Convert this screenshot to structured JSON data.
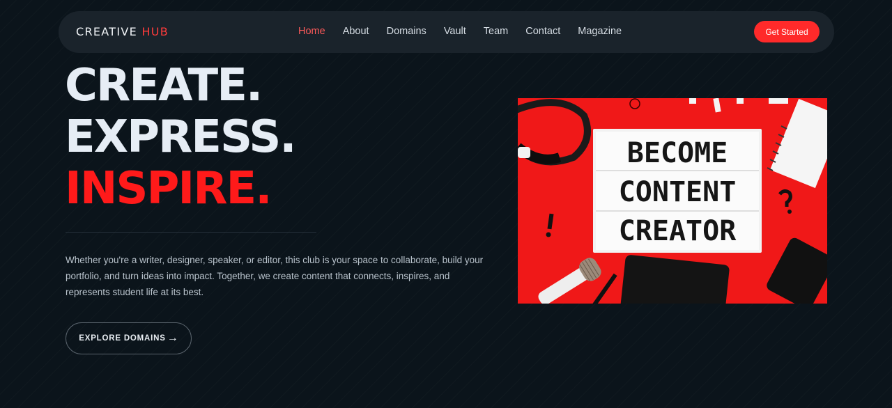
{
  "brand": {
    "name_part1": "CREATIVE",
    "name_part2": "HUB"
  },
  "nav": {
    "items": [
      {
        "label": "Home",
        "active": true
      },
      {
        "label": "About"
      },
      {
        "label": "Domains"
      },
      {
        "label": "Vault"
      },
      {
        "label": "Team"
      },
      {
        "label": "Contact"
      },
      {
        "label": "Magazine"
      }
    ],
    "cta_label": "Get Started"
  },
  "hero": {
    "line1": "CREATE.",
    "line2": "EXPRESS.",
    "line3": "INSPIRE.",
    "description": "Whether you're a writer, designer, speaker, or editor, this club is your space to collaborate, build your portfolio, and turn ideas into impact. Together, we create content that connects, inspires, and represents student life at its best.",
    "button_label": "EXPLORE DOMAINS",
    "button_icon": "arrow-right-icon"
  },
  "image": {
    "lightbox_lines": [
      "BECOME",
      "CONTENT",
      "CREATOR"
    ],
    "background_color": "#f01818"
  },
  "colors": {
    "accent": "#ff2a2a",
    "background": "#0b141b",
    "nav_bg": "#1a232b"
  }
}
